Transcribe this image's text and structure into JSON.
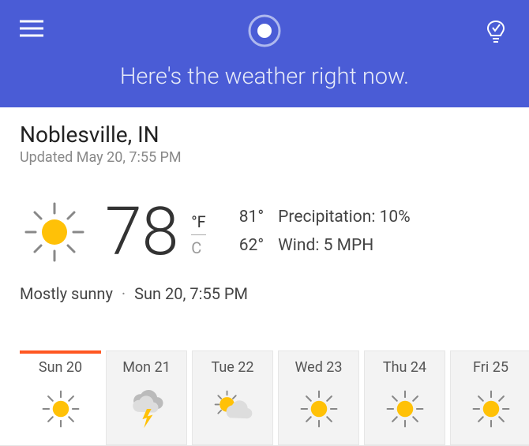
{
  "header": {
    "message": "Here's the weather right now."
  },
  "location": "Noblesville, IN",
  "updated_text": "Updated May 20, 7:55 PM",
  "current": {
    "temp": "78",
    "unit_f": "°F",
    "unit_c": "C",
    "high": "81°",
    "low": "62°",
    "precip_label": "Precipitation: 10%",
    "wind_label": "Wind: 5 MPH",
    "condition": "Mostly sunny",
    "as_of": "Sun 20, 7:55 PM"
  },
  "forecast": [
    {
      "label": "Sun 20",
      "icon": "sun",
      "active": true
    },
    {
      "label": "Mon 21",
      "icon": "thunderstorm",
      "active": false
    },
    {
      "label": "Tue 22",
      "icon": "partly-cloudy",
      "active": false
    },
    {
      "label": "Wed 23",
      "icon": "sun",
      "active": false
    },
    {
      "label": "Thu 24",
      "icon": "sun",
      "active": false
    },
    {
      "label": "Fri 25",
      "icon": "sun",
      "active": false
    }
  ],
  "icons": {
    "menu": "menu-icon",
    "cortana": "cortana-logo-icon",
    "tip": "lightbulb-check-icon"
  },
  "colors": {
    "accent": "#4a5cd6",
    "highlight": "#ff5722",
    "sun": "#ffc107"
  }
}
